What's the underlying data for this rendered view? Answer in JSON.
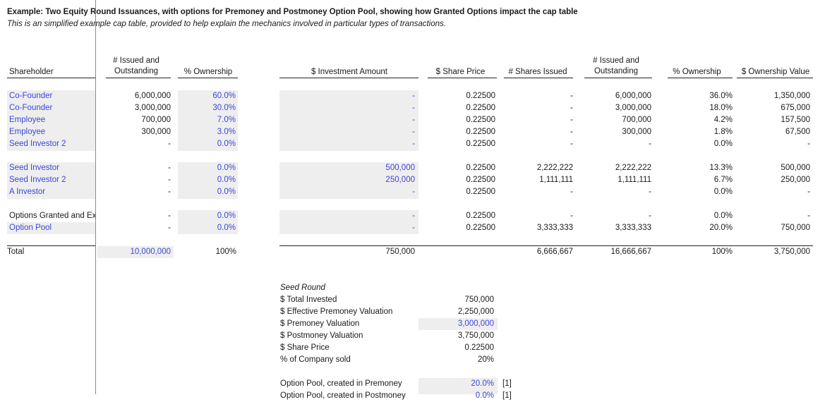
{
  "title": "Example: Two Equity Round Issuances, with options for Premoney and Postmoney Option Pool, showing how Granted Options impact the cap table",
  "subtitle": "This is an simplified example cap table, provided to help explain the mechanics involved in particular types of transactions.",
  "headers": {
    "shareholder": "Shareholder",
    "issued_line1": "# Issued and",
    "issued_line2": "Outstanding",
    "ownership": "% Ownership",
    "investment": "$ Investment Amount",
    "share_price": "$ Share Price",
    "shares_issued": "# Shares Issued",
    "issued2_line1": "# Issued and",
    "issued2_line2": "Outstanding",
    "ownership2": "% Ownership",
    "ownership_value": "$ Ownership Value"
  },
  "rows": [
    {
      "name": "Co-Founder",
      "issued": "6,000,000",
      "pct": "60.0%",
      "invest": "-",
      "price": "0.22500",
      "shares": "-",
      "issued2": "6,000,000",
      "pct2": "36.0%",
      "value": "1,350,000"
    },
    {
      "name": "Co-Founder",
      "issued": "3,000,000",
      "pct": "30.0%",
      "invest": "-",
      "price": "0.22500",
      "shares": "-",
      "issued2": "3,000,000",
      "pct2": "18.0%",
      "value": "675,000"
    },
    {
      "name": "Employee",
      "issued": "700,000",
      "pct": "7.0%",
      "invest": "-",
      "price": "0.22500",
      "shares": "-",
      "issued2": "700,000",
      "pct2": "4.2%",
      "value": "157,500"
    },
    {
      "name": "Employee",
      "issued": "300,000",
      "pct": "3.0%",
      "invest": "-",
      "price": "0.22500",
      "shares": "-",
      "issued2": "300,000",
      "pct2": "1.8%",
      "value": "67,500"
    },
    {
      "name": "Seed Investor 2",
      "issued": "-",
      "pct": "0.0%",
      "invest": "-",
      "price": "0.22500",
      "shares": "-",
      "issued2": "-",
      "pct2": "0.0%",
      "value": "-"
    },
    {
      "name": "Seed Investor",
      "issued": "-",
      "pct": "0.0%",
      "invest": "500,000",
      "price": "0.22500",
      "shares": "2,222,222",
      "issued2": "2,222,222",
      "pct2": "13.3%",
      "value": "500,000"
    },
    {
      "name": "Seed Investor 2",
      "issued": "-",
      "pct": "0.0%",
      "invest": "250,000",
      "price": "0.22500",
      "shares": "1,111,111",
      "issued2": "1,111,111",
      "pct2": "6.7%",
      "value": "250,000"
    },
    {
      "name": "A Investor",
      "issued": "-",
      "pct": "0.0%",
      "invest": "-",
      "price": "0.22500",
      "shares": "-",
      "issued2": "-",
      "pct2": "0.0%",
      "value": "-"
    },
    {
      "name": "Options Granted and Exercised",
      "issued": "-",
      "pct": "0.0%",
      "invest": "-",
      "price": "0.22500",
      "shares": "-",
      "issued2": "-",
      "pct2": "0.0%",
      "value": "-"
    },
    {
      "name": "Option Pool",
      "issued": "-",
      "pct": "0.0%",
      "invest": "-",
      "price": "0.22500",
      "shares": "3,333,333",
      "issued2": "3,333,333",
      "pct2": "20.0%",
      "value": "750,000"
    }
  ],
  "total": {
    "label": "Total",
    "issued": "10,000,000",
    "pct": "100%",
    "invest": "750,000",
    "shares": "6,666,667",
    "issued2": "16,666,667",
    "pct2": "100%",
    "value": "3,750,000"
  },
  "summary": {
    "heading": "Seed Round",
    "items": [
      {
        "label": "$ Total Invested",
        "value": "750,000"
      },
      {
        "label": "$ Effective Premoney Valuation",
        "value": "2,250,000"
      },
      {
        "label": "$ Premoney Valuation",
        "value": "3,000,000"
      },
      {
        "label": "$ Postmoney Valuation",
        "value": "3,750,000"
      },
      {
        "label": "$ Share Price",
        "value": "0.22500"
      },
      {
        "label": "% of Company sold",
        "value": "20%"
      }
    ],
    "option_pool_label": "Option Pool, created in Premoney",
    "option_pool_value": "20.0%",
    "option_pool_note": "[1]",
    "option_pool2_label": "Option Pool, created in Postmoney",
    "option_pool2_value": "0.0%",
    "option_pool2_note": "[1]"
  },
  "colors": {
    "input_blue": "#3b47d8",
    "shade": "#eeeeee"
  }
}
